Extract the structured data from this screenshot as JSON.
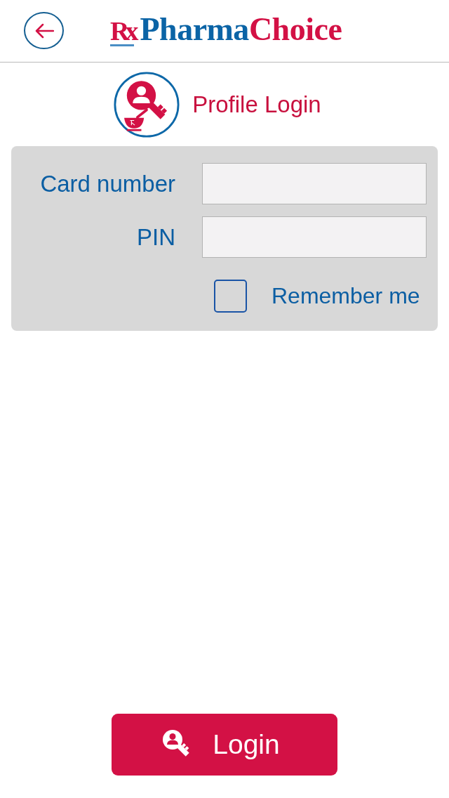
{
  "header": {
    "logo": {
      "mark": "Rx",
      "parts": [
        {
          "text": "Pharma",
          "color": "#0b64a6"
        },
        {
          "text": "Choice",
          "color": "#d31145"
        }
      ]
    }
  },
  "section": {
    "title": "Profile Login"
  },
  "form": {
    "fields": [
      {
        "label": "Card number"
      },
      {
        "label": "PIN"
      }
    ],
    "remember": {
      "label": "Remember me",
      "checked": false
    }
  },
  "login_button": {
    "label": "Login"
  }
}
